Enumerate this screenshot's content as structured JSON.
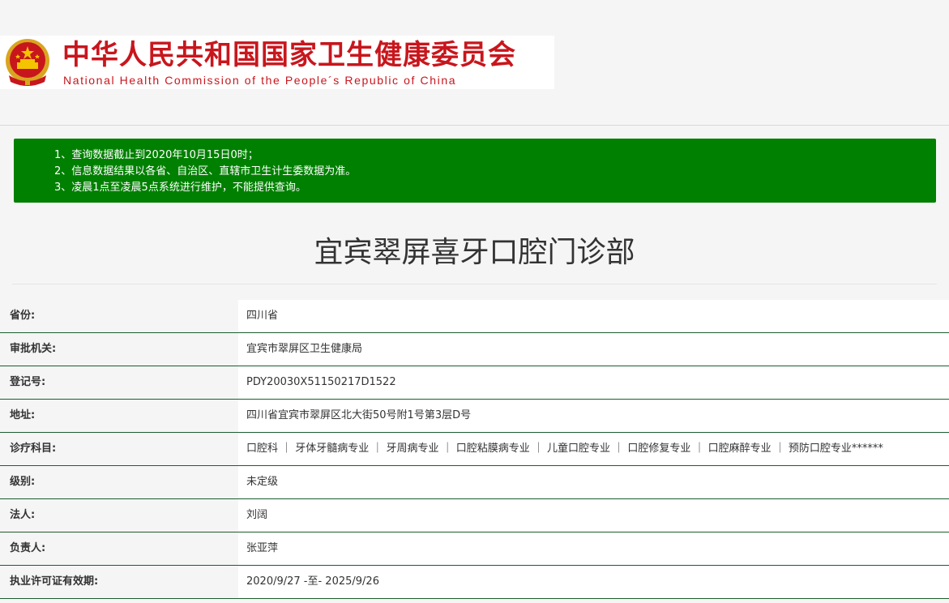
{
  "header": {
    "cn_title": "中华人民共和国国家卫生健康委员会",
    "en_title": "National Health Commission of the People´s Republic of China",
    "emblem_icon": "national-emblem-icon",
    "brand_color": "#c8161d"
  },
  "notice": {
    "color": "#008000",
    "lines": [
      "1、查询数据截止到2020年10月15日0时；",
      "2、信息数据结果以各省、自治区、直辖市卫生计生委数据为准。",
      "3、凌晨1点至凌晨5点系统进行维护，不能提供查询。"
    ]
  },
  "title": "宜宾翠屏喜牙口腔门诊部",
  "info": [
    {
      "label": "省份:",
      "value": "四川省"
    },
    {
      "label": "审批机关:",
      "value": "宜宾市翠屏区卫生健康局"
    },
    {
      "label": "登记号:",
      "value": "PDY20030X51150217D1522"
    },
    {
      "label": "地址:",
      "value": "四川省宜宾市翠屏区北大街50号附1号第3层D号"
    },
    {
      "label": "诊疗科目:",
      "value": "口腔科 ｜ 牙体牙髓病专业 ｜ 牙周病专业 ｜ 口腔粘膜病专业 ｜ 儿童口腔专业 ｜ 口腔修复专业 ｜ 口腔麻醉专业 ｜ 预防口腔专业******"
    },
    {
      "label": "级别:",
      "value": "未定级"
    },
    {
      "label": "法人:",
      "value": "刘阔"
    },
    {
      "label": "负责人:",
      "value": "张亚萍"
    },
    {
      "label": "执业许可证有效期:",
      "value": "2020/9/27 -至- 2025/9/26"
    }
  ]
}
